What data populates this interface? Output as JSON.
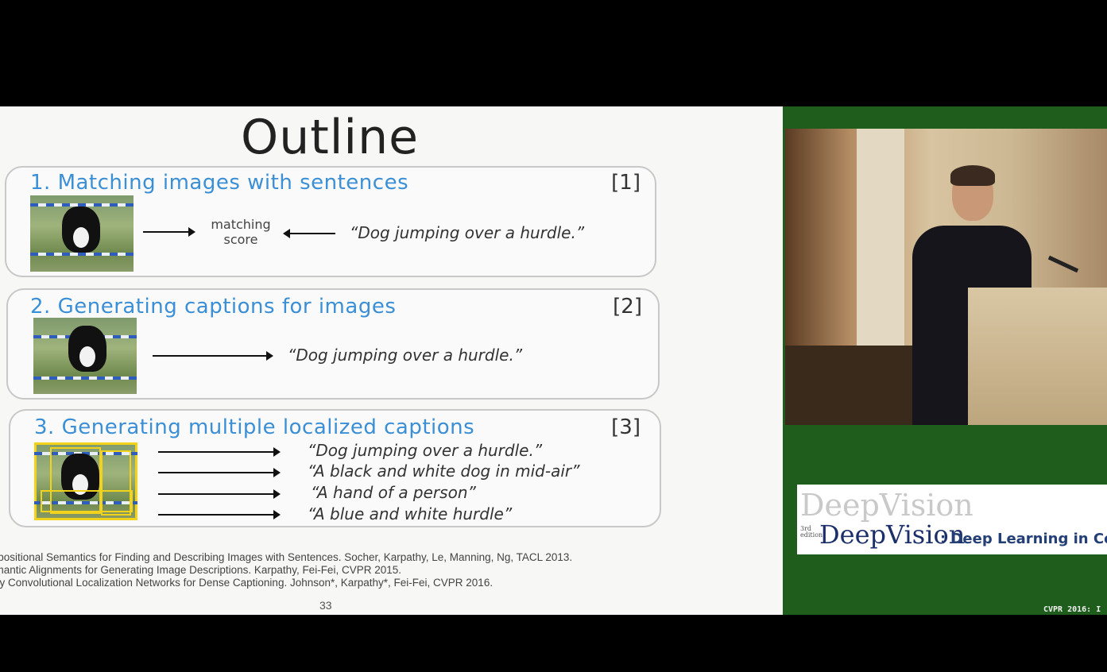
{
  "slide": {
    "title": "Outline",
    "panels": [
      {
        "title": "1. Matching images with sentences",
        "ref": "[1]",
        "score_label_line1": "matching",
        "score_label_line2": "score",
        "caption": "“Dog jumping over a hurdle.”"
      },
      {
        "title": "2. Generating captions for images",
        "ref": "[2]",
        "caption": "“Dog jumping over a hurdle.”"
      },
      {
        "title": "3. Generating multiple localized captions",
        "ref": "[3]",
        "captions": [
          "“Dog jumping over a hurdle.”",
          "“A black and white dog in mid-air”",
          "“A hand of a person”",
          "“A blue and white hurdle”"
        ]
      }
    ],
    "references": [
      "mpositional Semantics for Finding and Describing Images with Sentences. Socher, Karpathy, Le, Manning, Ng, TACL 2013.",
      "emantic Alignments for Generating Image Descriptions. Karpathy, Fei-Fei, CVPR 2015.",
      "ully Convolutional Localization Networks for Dense Captioning. Johnson*, Karpathy*, Fei-Fei, CVPR 2016."
    ],
    "page_number": "33"
  },
  "sidebar": {
    "logo_ghost": "DeepVision",
    "logo_edition_1": "3rd",
    "logo_edition_2": "edition",
    "logo_main": "DeepVision",
    "logo_sub": ": Deep Learning in Comp",
    "footer": "CVPR 2016: I"
  },
  "colors": {
    "title_blue": "#3a8fd6",
    "side_green": "#1f5d1c",
    "logo_blue": "#1c2f6b"
  }
}
